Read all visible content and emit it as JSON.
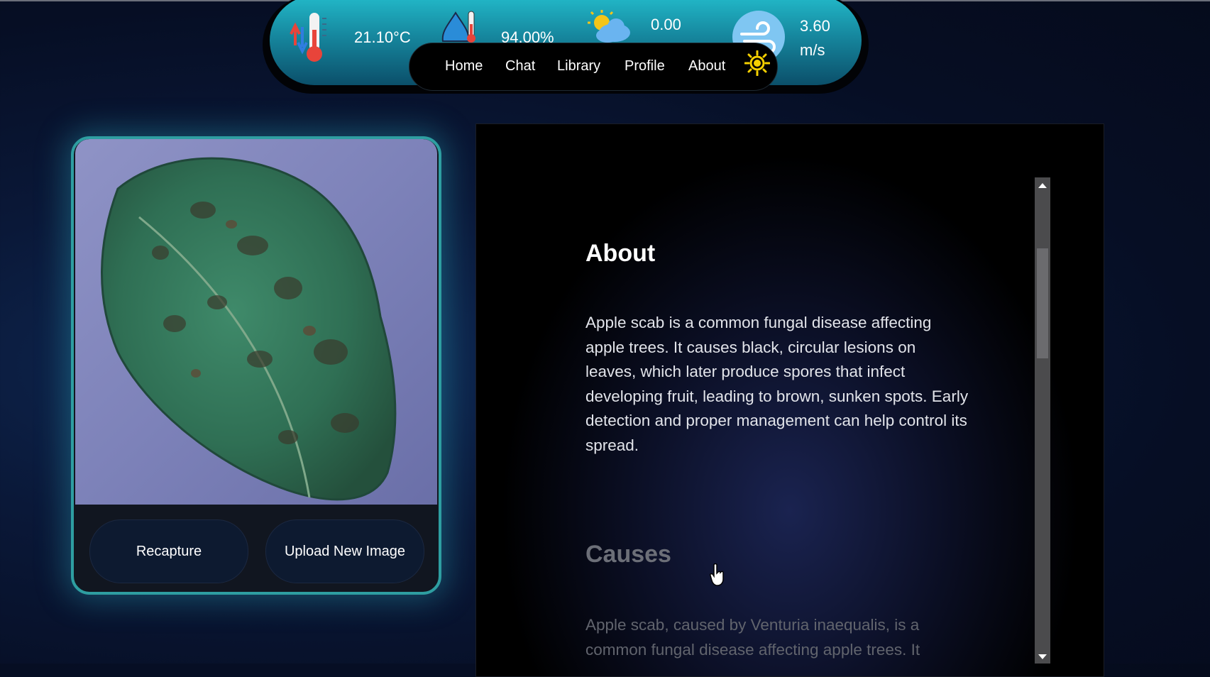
{
  "weather": {
    "temperature": "21.10°C",
    "humidity": "94.00%",
    "rainfall": "0.00",
    "wind_value": "3.60",
    "wind_unit": "m/s",
    "icons": [
      "thermometer-icon",
      "humidity-icon",
      "partly-cloudy-icon",
      "wind-icon"
    ]
  },
  "nav": {
    "items": [
      "Home",
      "Chat",
      "Library",
      "Profile",
      "About"
    ],
    "theme_icon": "sun-icon"
  },
  "card": {
    "image": "apple-scab-leaf-image",
    "recapture_label": "Recapture",
    "upload_label": "Upload New Image"
  },
  "content": {
    "about_heading": "About",
    "about_text": "Apple scab is a common fungal disease affecting apple trees. It causes black, circular lesions on leaves, which later produce spores that infect developing fruit, leading to brown, sunken spots. Early detection and proper management can help control its spread.",
    "causes_heading": "Causes",
    "causes_text": "Apple scab, caused by Venturia inaequalis, is a common fungal disease affecting apple trees. It"
  },
  "colors": {
    "accent": "#2e9ea1",
    "weather_bar": "#1a9fb5",
    "sun": "#f5d000"
  }
}
